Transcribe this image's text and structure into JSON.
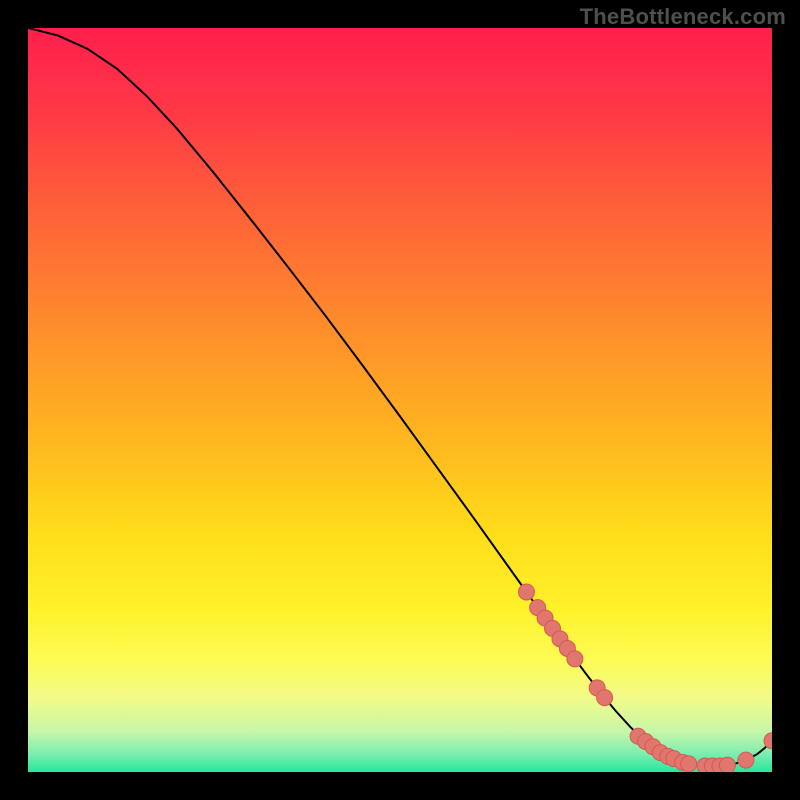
{
  "watermark": "TheBottleneck.com",
  "colors": {
    "black": "#000000",
    "line": "#000000",
    "marker_fill": "#e0766d",
    "marker_stroke": "#d55a52"
  },
  "chart_data": {
    "type": "line",
    "title": "",
    "xlabel": "",
    "ylabel": "",
    "xlim": [
      0,
      100
    ],
    "ylim": [
      0,
      100
    ],
    "background_gradient": {
      "direction": "vertical",
      "stops": [
        {
          "pos": 0.0,
          "color": "#ff1f4c"
        },
        {
          "pos": 0.1,
          "color": "#ff3547"
        },
        {
          "pos": 0.25,
          "color": "#ff6238"
        },
        {
          "pos": 0.4,
          "color": "#ff8c2c"
        },
        {
          "pos": 0.55,
          "color": "#ffb61f"
        },
        {
          "pos": 0.68,
          "color": "#ffdd1a"
        },
        {
          "pos": 0.78,
          "color": "#fff22a"
        },
        {
          "pos": 0.85,
          "color": "#fdfb55"
        },
        {
          "pos": 0.9,
          "color": "#f2fb88"
        },
        {
          "pos": 0.945,
          "color": "#c8f6a8"
        },
        {
          "pos": 0.975,
          "color": "#7eeeb0"
        },
        {
          "pos": 1.0,
          "color": "#28e69e"
        }
      ]
    },
    "series": [
      {
        "name": "curve",
        "x": [
          0,
          4,
          8,
          12,
          16,
          20,
          25,
          30,
          35,
          40,
          45,
          50,
          55,
          60,
          65,
          67,
          69,
          71,
          73,
          75,
          77,
          79,
          81,
          83,
          85,
          87,
          89,
          91,
          93,
          95,
          96.5,
          98,
          99,
          100
        ],
        "y": [
          100,
          99,
          97.2,
          94.5,
          90.8,
          86.5,
          80.5,
          74.2,
          67.8,
          61.3,
          54.6,
          47.8,
          40.9,
          34.0,
          27.0,
          24.2,
          21.4,
          18.6,
          15.9,
          13.2,
          10.6,
          8.2,
          6.0,
          4.1,
          2.6,
          1.6,
          1.0,
          0.8,
          0.8,
          1.1,
          1.6,
          2.4,
          3.2,
          4.2
        ]
      }
    ],
    "markers": {
      "name": "highlight-points",
      "x": [
        67,
        68.5,
        69.5,
        70.5,
        71.5,
        72.5,
        73.5,
        76.5,
        77.5,
        82,
        83,
        84,
        85,
        86,
        86.8,
        88,
        88.8,
        91,
        92,
        93,
        94,
        96.5,
        100
      ],
      "y": [
        24.2,
        22.1,
        20.7,
        19.3,
        17.9,
        16.6,
        15.2,
        11.3,
        10.0,
        4.8,
        4.1,
        3.4,
        2.6,
        2.1,
        1.8,
        1.3,
        1.1,
        0.8,
        0.8,
        0.8,
        0.9,
        1.6,
        4.2
      ]
    }
  }
}
